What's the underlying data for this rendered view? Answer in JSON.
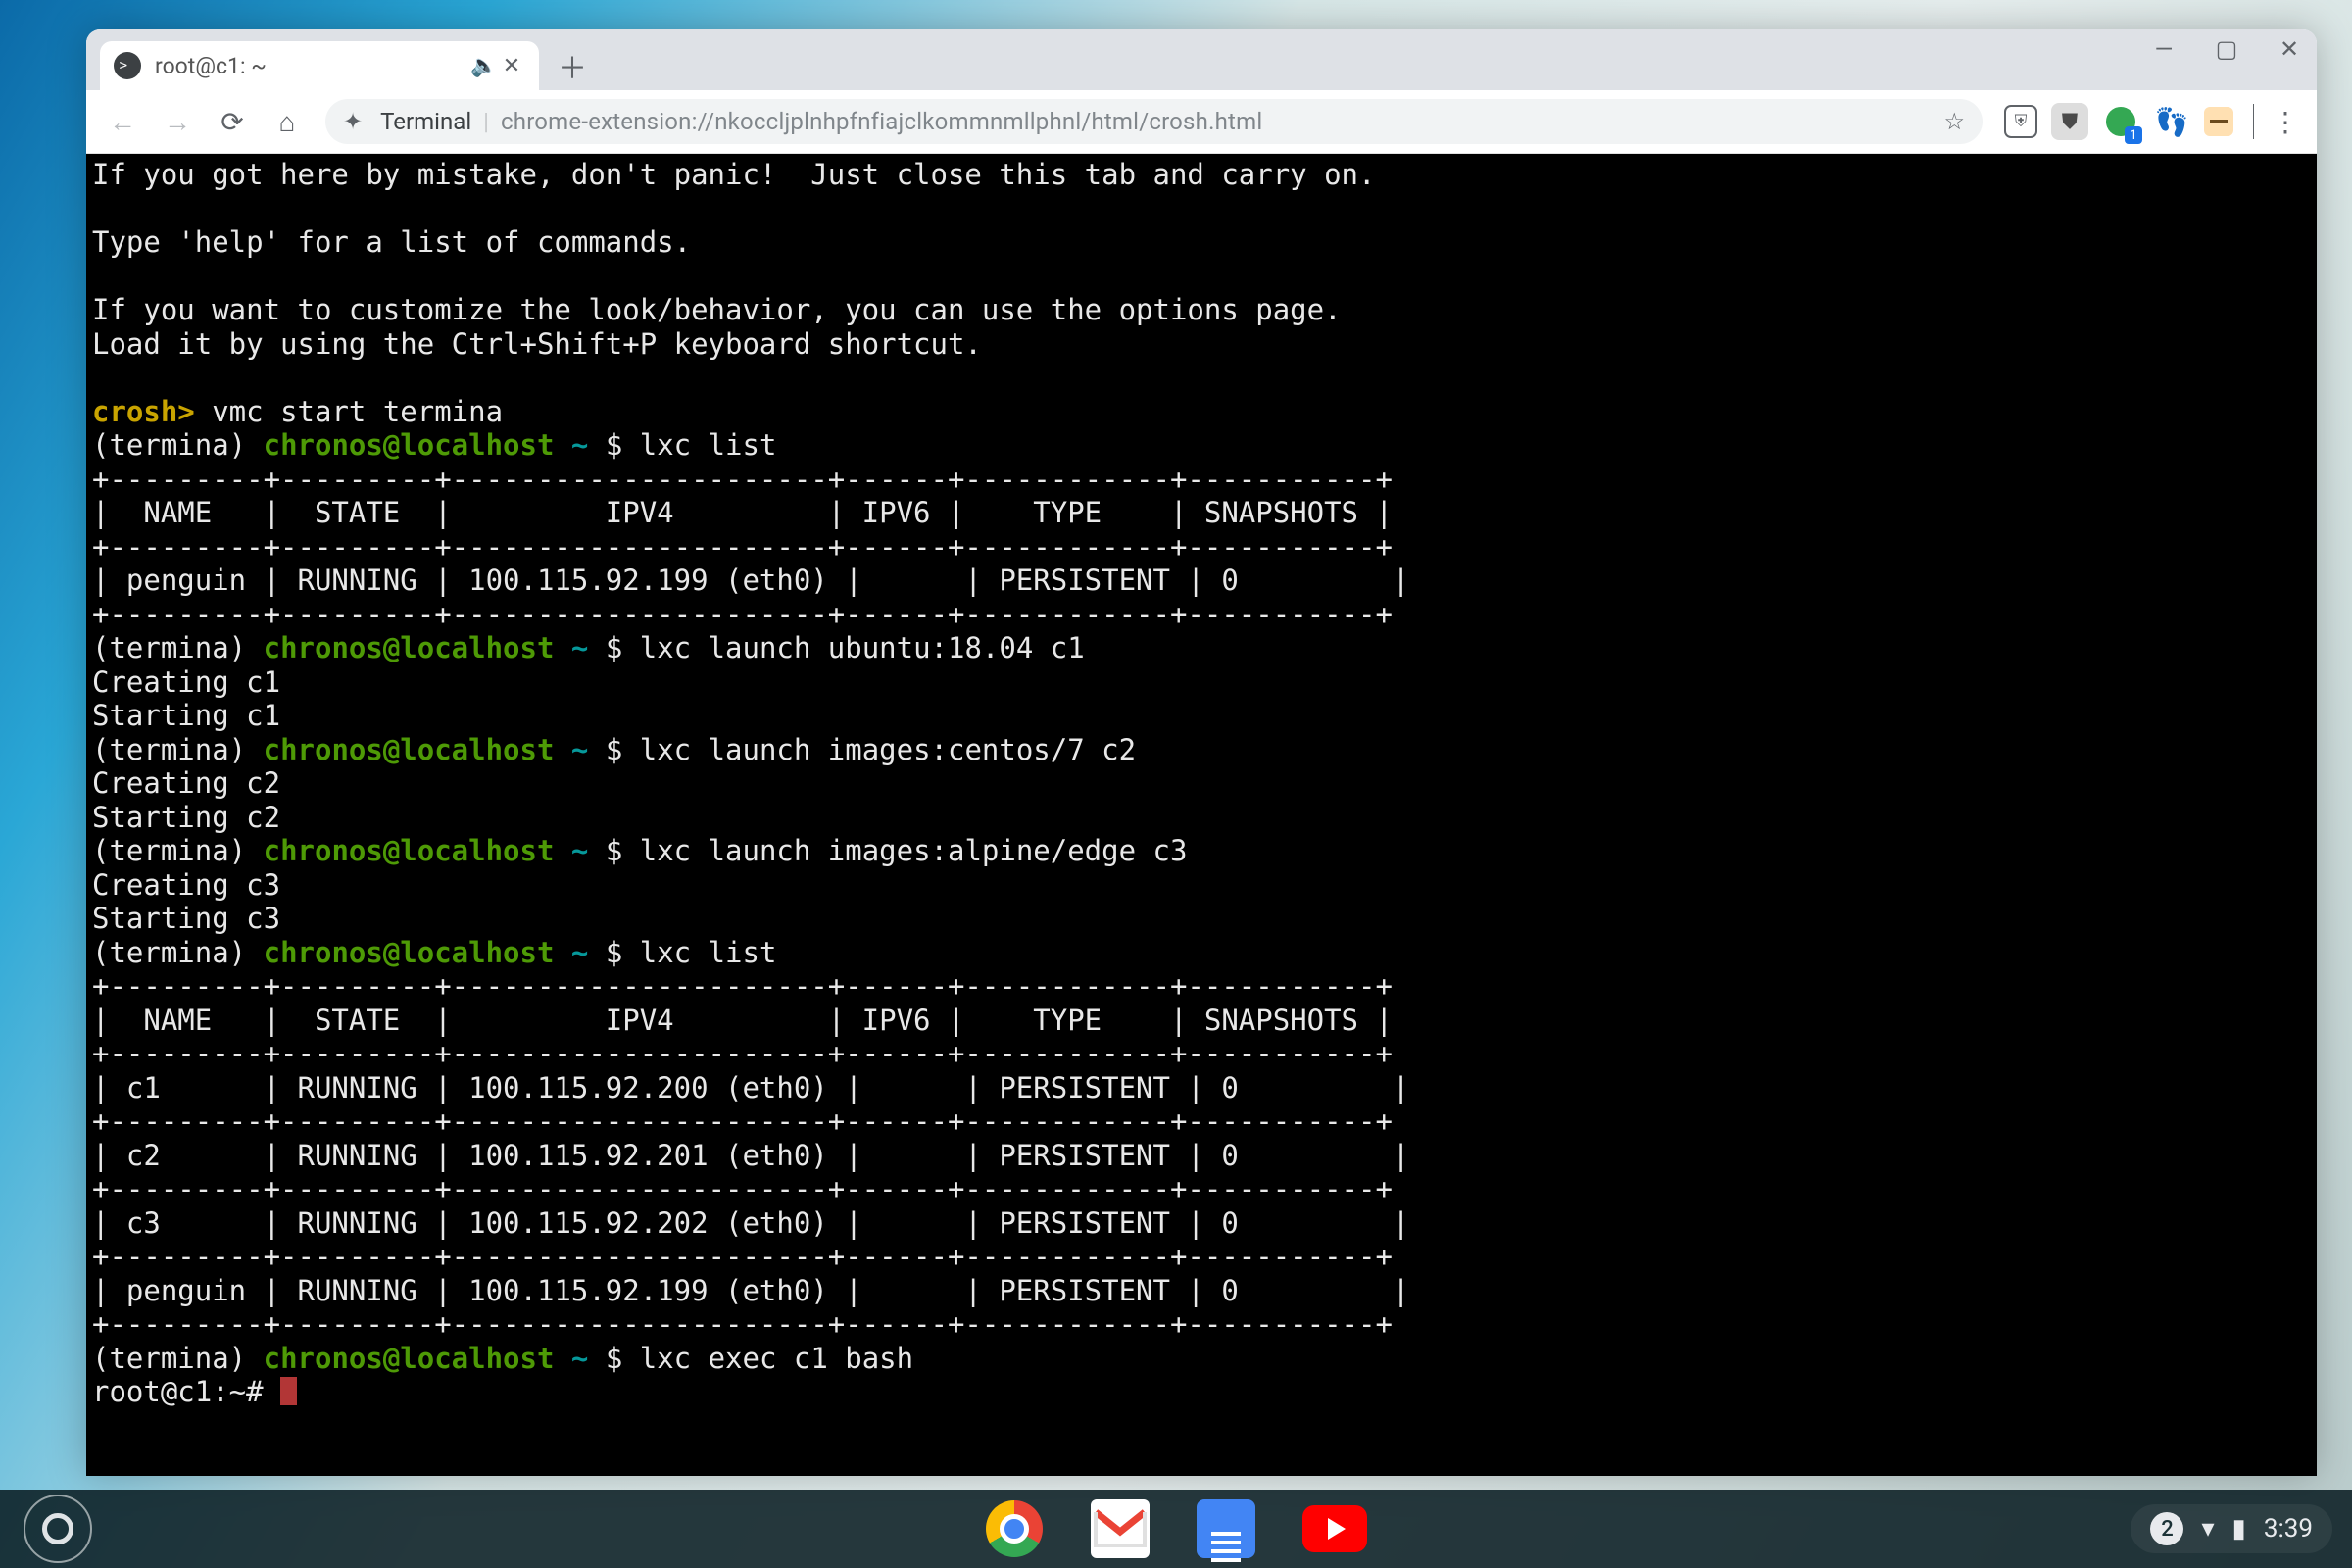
{
  "tab": {
    "title": "root@c1: ~",
    "audio_icon": "audio-icon",
    "close_icon": "close-icon"
  },
  "window_controls": {
    "min": "—",
    "max": "▢",
    "close": "✕"
  },
  "toolbar": {
    "ext_label": "Terminal",
    "url": "chrome-extension://nkoccljplnhpfnfiajclkommnmllphnl/html/crosh.html"
  },
  "ext_badge": "1",
  "terminal": {
    "intro1": "If you got here by mistake, don't panic!  Just close this tab and carry on.",
    "intro2": "Type 'help' for a list of commands.",
    "intro3": "If you want to customize the look/behavior, you can use the options page.",
    "intro4": "Load it by using the Ctrl+Shift+P keyboard shortcut.",
    "crosh_prompt": "crosh>",
    "crosh_cmd": " vmc start termina",
    "p_open": "(termina) ",
    "p_user": "chronos@localhost",
    "p_path": " ~ ",
    "p_dollar": "$ ",
    "cmd_list1": "lxc list",
    "divider": "+---------+---------+----------------------+------+------------+-----------+",
    "hdr": "|  NAME   |  STATE  |         IPV4         | IPV6 |    TYPE    | SNAPSHOTS |",
    "row_pen": "| penguin | RUNNING | 100.115.92.199 (eth0) |      | PERSISTENT | 0         |",
    "cmd_launch1": "lxc launch ubuntu:18.04 c1",
    "creating1": "Creating c1",
    "starting1": "Starting c1",
    "cmd_launch2": "lxc launch images:centos/7 c2",
    "creating2": "Creating c2",
    "starting2": "Starting c2",
    "cmd_launch3": "lxc launch images:alpine/edge c3",
    "creating3": "Creating c3",
    "starting3": "Starting c3",
    "cmd_list2": "lxc list",
    "row_c1": "| c1      | RUNNING | 100.115.92.200 (eth0) |      | PERSISTENT | 0         |",
    "row_c2": "| c2      | RUNNING | 100.115.92.201 (eth0) |      | PERSISTENT | 0         |",
    "row_c3": "| c3      | RUNNING | 100.115.92.202 (eth0) |      | PERSISTENT | 0         |",
    "row_pen2": "| penguin | RUNNING | 100.115.92.199 (eth0) |      | PERSISTENT | 0         |",
    "cmd_exec": "lxc exec c1 bash",
    "root_prompt": "root@c1:~# "
  },
  "status": {
    "notif_count": "2",
    "clock": "3:39"
  }
}
